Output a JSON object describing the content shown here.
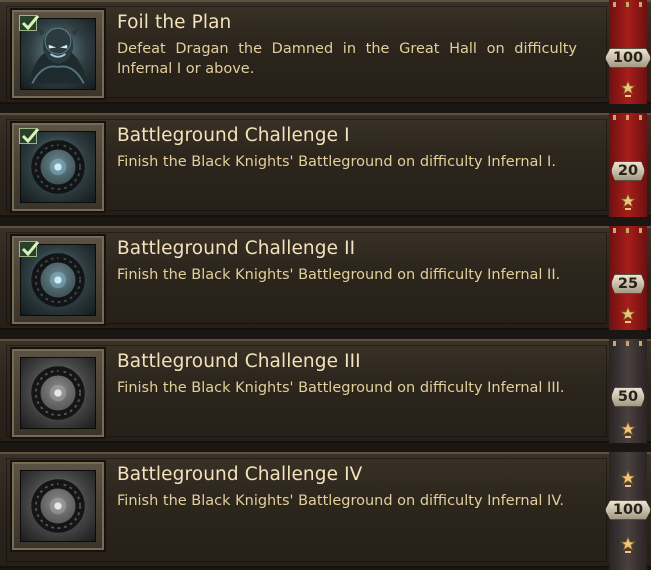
{
  "achievements": [
    {
      "title": "Foil the Plan",
      "description": "Defeat Dragan the Damned in the Great Hall on difficulty Infernal I or above.",
      "points": "100",
      "completed": true,
      "icon": "dragan-portrait-icon"
    },
    {
      "title": "Battleground Challenge I",
      "description": "Finish the Black Knights' Battleground on difficulty Infernal I.",
      "points": "20",
      "completed": true,
      "icon": "serpent-ring-icon"
    },
    {
      "title": "Battleground Challenge II",
      "description": "Finish the Black Knights' Battleground on difficulty Infernal II.",
      "points": "25",
      "completed": true,
      "icon": "serpent-ring-icon"
    },
    {
      "title": "Battleground Challenge III",
      "description": "Finish the Black Knights' Battleground on difficulty Infernal III.",
      "points": "50",
      "completed": false,
      "icon": "serpent-ring-icon"
    },
    {
      "title": "Battleground Challenge IV",
      "description": "Finish the Black Knights' Battleground on difficulty Infernal IV.",
      "points": "100",
      "completed": false,
      "icon": "serpent-ring-icon"
    }
  ],
  "colors": {
    "completed_ribbon": "#a71e1b",
    "locked_ribbon": "#4a4040",
    "title_text": "#f3e2bb",
    "description_text": "#e3cf9b"
  },
  "icons": {
    "completed_mark": "checkmark-icon",
    "reward": "star-icon"
  }
}
